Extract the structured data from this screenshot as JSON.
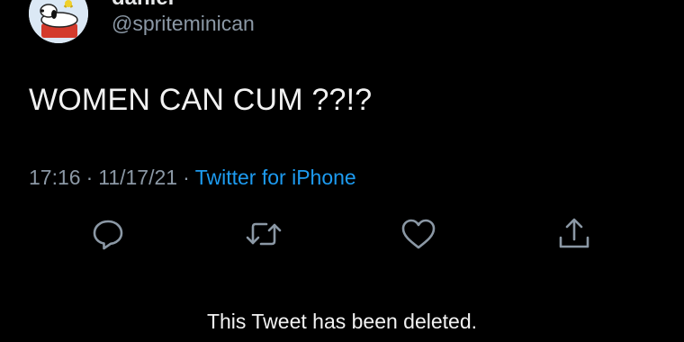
{
  "tweet": {
    "display_name": "daniel",
    "handle": "@spriteminican",
    "text": "WOMEN CAN CUM ??!?",
    "time": "17:16",
    "date": "11/17/21",
    "separator": "·",
    "source": "Twitter for iPhone"
  },
  "actions": [
    {
      "name": "reply",
      "icon": "speech-bubble-icon"
    },
    {
      "name": "retweet",
      "icon": "retweet-arrows-icon"
    },
    {
      "name": "like",
      "icon": "heart-icon"
    },
    {
      "name": "share",
      "icon": "share-upload-icon"
    }
  ],
  "notice": "This Tweet has been deleted.",
  "colors": {
    "background": "#000000",
    "secondary_text": "#8b98a5",
    "link": "#1d9bf0",
    "icon": "#8b98a5"
  }
}
